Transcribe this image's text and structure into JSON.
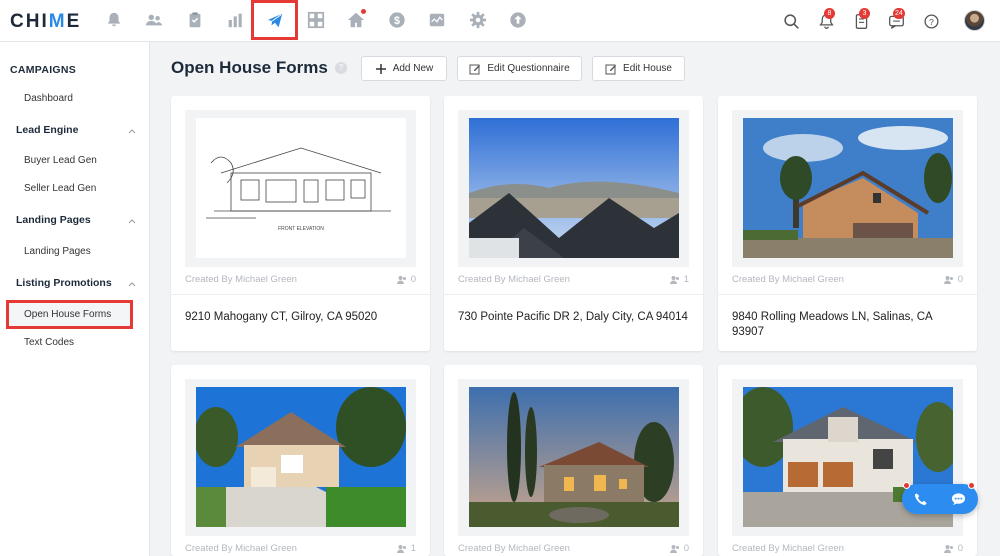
{
  "app": {
    "logo_text": "CHIME",
    "logo_accent_letter": "M"
  },
  "topnav": {
    "icons": [
      "bell-icon",
      "people-icon",
      "clipboard-icon",
      "bar-chart-icon",
      "paper-plane-icon",
      "grid-icon",
      "home-icon",
      "dollar-icon",
      "activity-icon",
      "gear-icon",
      "upload-icon"
    ],
    "active_icon": "paper-plane-icon"
  },
  "toolbar_right": {
    "notifications_count": "8",
    "tasks_count": "3",
    "messages_count": "24"
  },
  "sidebar": {
    "section_title": "CAMPAIGNS",
    "dashboard": "Dashboard",
    "groups": [
      {
        "label": "Lead Engine",
        "items": [
          "Buyer Lead Gen",
          "Seller Lead Gen"
        ]
      },
      {
        "label": "Landing Pages",
        "items": [
          "Landing Pages"
        ]
      },
      {
        "label": "Listing Promotions",
        "items": [
          "Open House Forms",
          "Text Codes"
        ]
      }
    ],
    "active_item": "Open House Forms"
  },
  "header": {
    "title": "Open House Forms",
    "help_glyph": "?",
    "add_new": "Add New",
    "edit_questionnaire": "Edit Questionnaire",
    "edit_house": "Edit House"
  },
  "cards": [
    {
      "created_by": "Created By Michael Green",
      "count": "0",
      "address": "9210 Mahogany CT, Gilroy, CA 95020",
      "image": "floor-plan-elevation"
    },
    {
      "created_by": "Created By Michael Green",
      "count": "1",
      "address": "730 Pointe Pacific DR 2, Daly City, CA 94014",
      "image": "rooftops-city-view"
    },
    {
      "created_by": "Created By Michael Green",
      "count": "0",
      "address": "9840 Rolling Meadows LN, Salinas, CA 93907",
      "image": "two-story-house-pines"
    },
    {
      "created_by": "Created By Michael Green",
      "count": "1",
      "address": "",
      "image": "suburban-house-driveway"
    },
    {
      "created_by": "Created By Michael Green",
      "count": "0",
      "address": "",
      "image": "tuscan-villa-dusk"
    },
    {
      "created_by": "Created By Michael Green",
      "count": "0",
      "address": "",
      "image": "craftsman-house-garage"
    }
  ],
  "colors": {
    "brand": "#1d2a3a",
    "accent": "#2a88e6",
    "highlight": "#e53935",
    "widget": "#2d8cf0"
  }
}
